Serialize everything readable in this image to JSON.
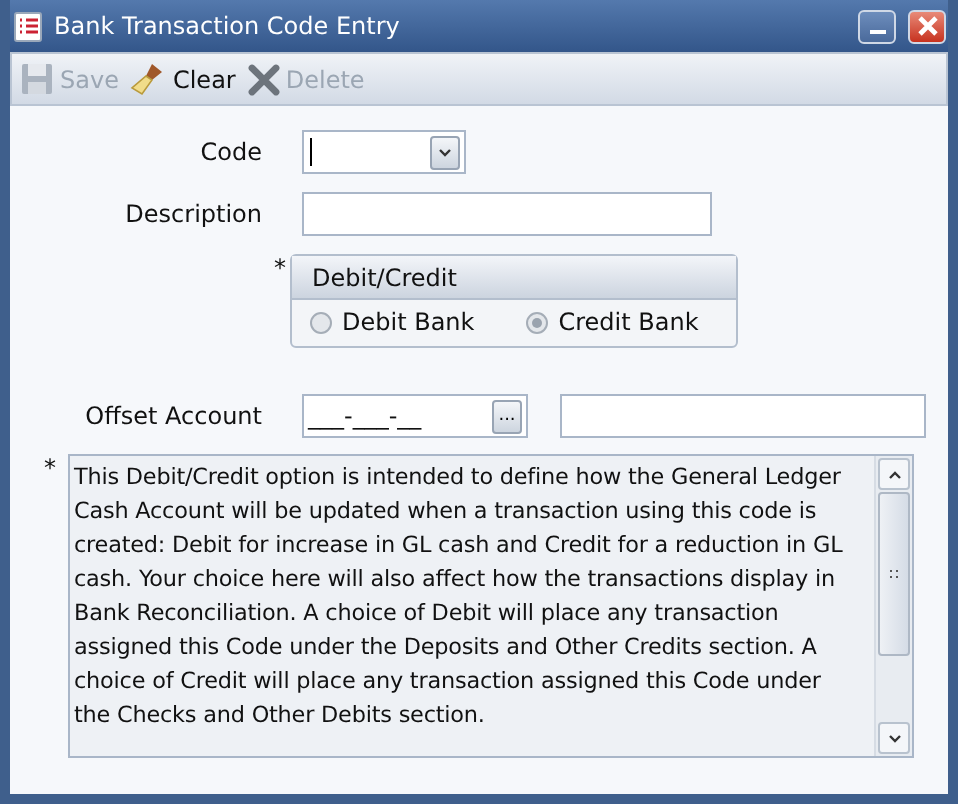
{
  "window": {
    "title": "Bank Transaction Code Entry"
  },
  "toolbar": [
    {
      "kind": "save",
      "label": "Save",
      "disabled": true
    },
    {
      "kind": "clear",
      "label": "Clear",
      "disabled": false
    },
    {
      "kind": "delete",
      "label": "Delete",
      "disabled": true
    }
  ],
  "form": {
    "code": {
      "label": "Code"
    },
    "description": {
      "label": "Description"
    },
    "debit_credit": {
      "required_mark": "*",
      "title": "Debit/Credit",
      "disabled": true,
      "options": [
        {
          "label": "Debit Bank",
          "selected": false
        },
        {
          "label": "Credit Bank",
          "selected": true
        }
      ]
    },
    "offset_account": {
      "label": "Offset Account",
      "value": "___-___-__",
      "button": "..."
    },
    "note": {
      "required_mark": "*",
      "text": "This Debit/Credit option is intended to define how the General Ledger Cash Account will be updated when a transaction using this code is created: Debit for increase in GL cash and Credit for a reduction in GL cash. Your choice here will also affect how the transactions display in Bank Reconciliation. A choice of Debit will place any transaction assigned this Code under the Deposits and Other Credits section. A choice of Credit will place any transaction assigned this Code under the Checks and Other Debits section."
    }
  }
}
